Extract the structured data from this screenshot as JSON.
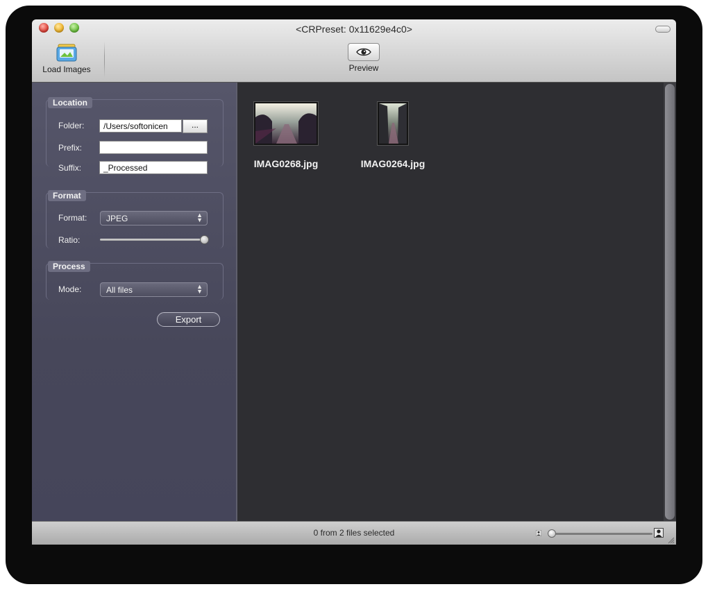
{
  "window": {
    "title": "<CRPreset: 0x11629e4c0>"
  },
  "toolbar": {
    "load_images_label": "Load Images",
    "preview_label": "Preview"
  },
  "sidebar": {
    "location": {
      "label": "Location",
      "folder_label": "Folder:",
      "folder_value": "/Users/softonicen",
      "browse_label": "...",
      "prefix_label": "Prefix:",
      "prefix_value": "",
      "suffix_label": "Suffix:",
      "suffix_value": "_Processed"
    },
    "format": {
      "label": "Format",
      "format_label": "Format:",
      "format_value": "JPEG",
      "ratio_label": "Ratio:",
      "ratio_level": 1.0
    },
    "process": {
      "label": "Process",
      "mode_label": "Mode:",
      "mode_value": "All files"
    },
    "export_label": "Export"
  },
  "images": [
    {
      "name": "IMAG0268.jpg",
      "orientation": "landscape"
    },
    {
      "name": "IMAG0264.jpg",
      "orientation": "portrait"
    }
  ],
  "statusbar": {
    "text": "0 from 2 files selected",
    "zoom_level": 0.0
  },
  "icons": {
    "load_images": "photo-stack-icon",
    "preview": "eye-icon",
    "zoom_small": "person-small-icon",
    "zoom_large": "person-large-icon"
  }
}
